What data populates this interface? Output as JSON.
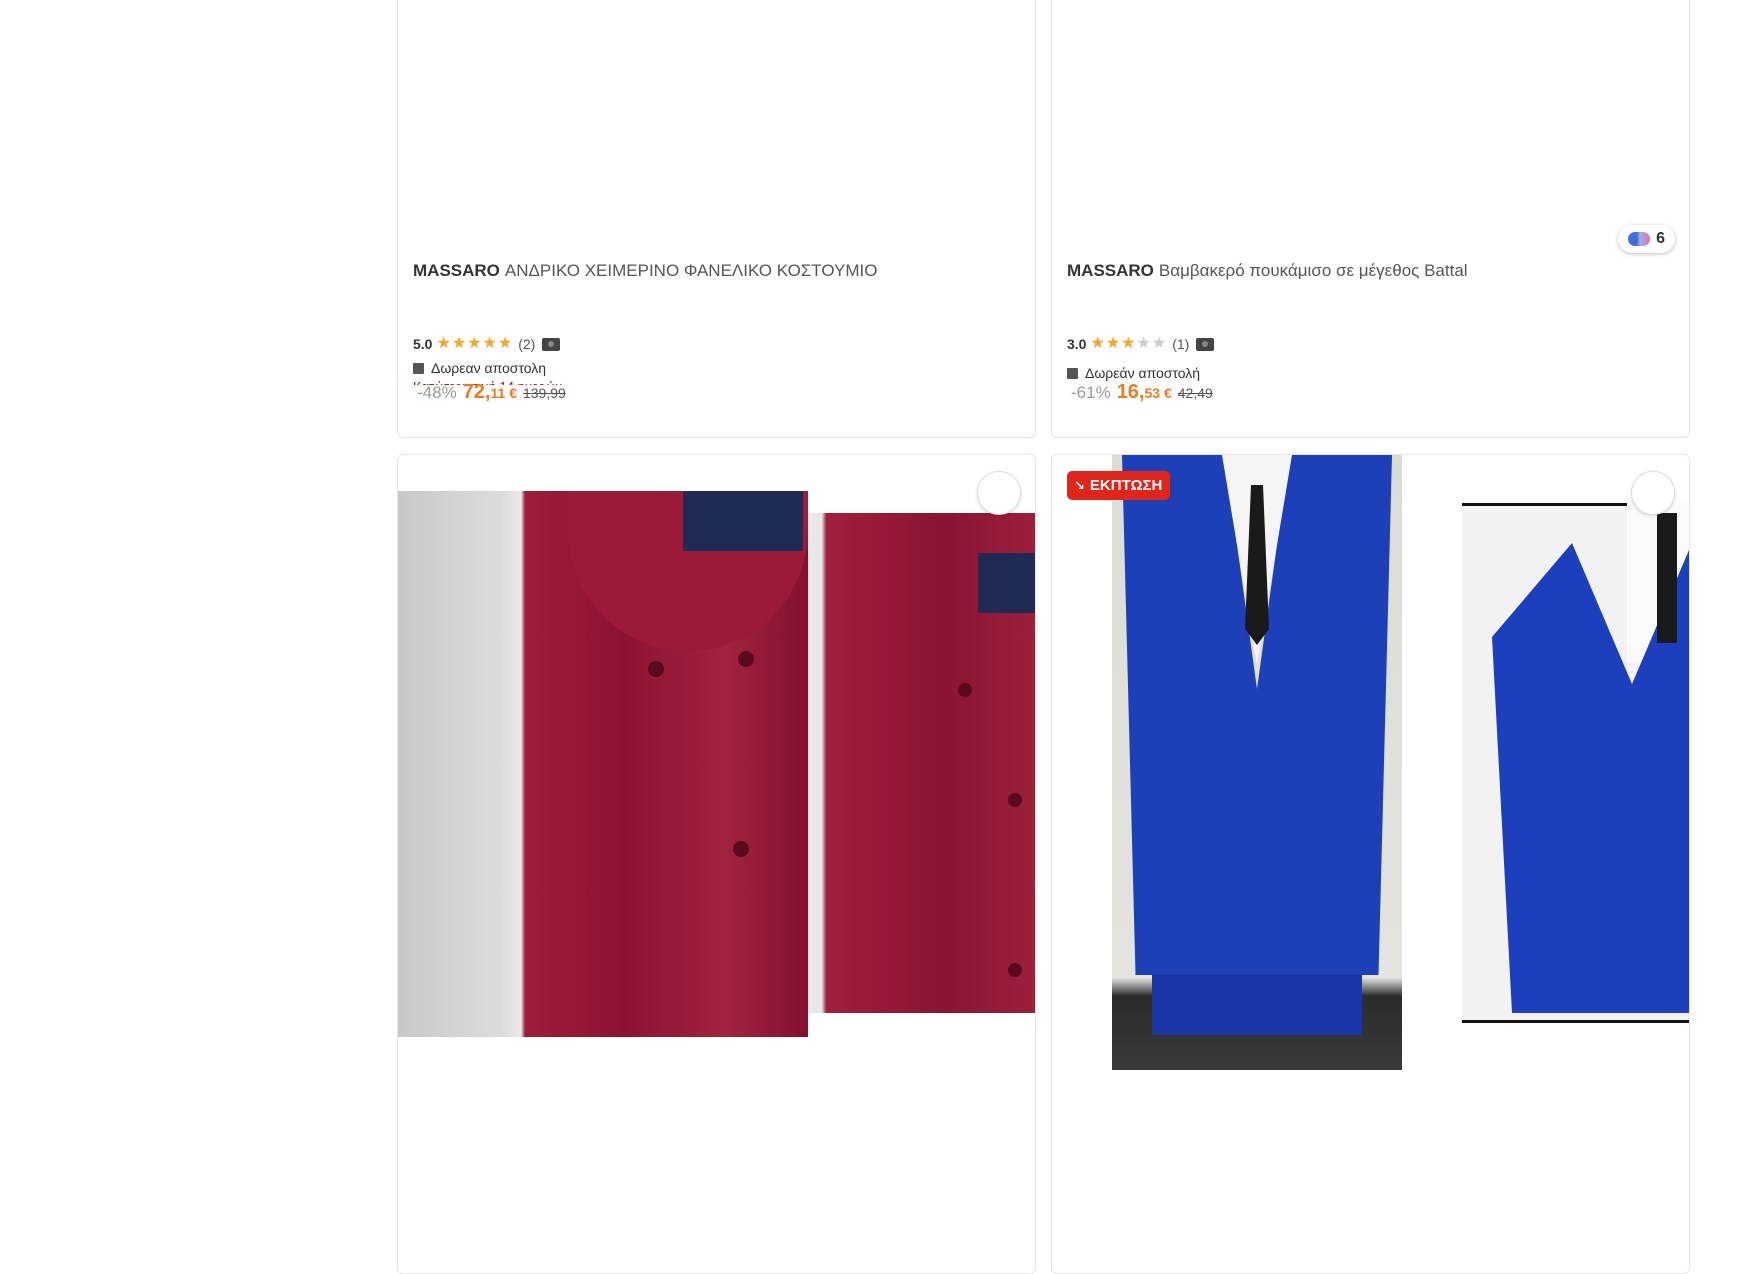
{
  "products": [
    {
      "brand": "MASSARO",
      "name": "ΑΝΔΡΙΚΟ ΧΕΙΜΕΡΙΝΟ ΦΑΝΕΛΙΚΟ ΚΟΣΤΟΥΜΙΟ",
      "rating": "5.0",
      "rating_value": 5,
      "review_count": "(2)",
      "shipping": "Δωρεαν αποστολη",
      "promo_partial": "Κατώτερη τιμή 14 ημερών",
      "discount": "-48%",
      "price_main": "72,",
      "price_cents": "11 €",
      "old_price": "139,99"
    },
    {
      "brand": "MASSARO",
      "name": "Βαμβακερό πουκάμισο σε μέγεθος Battal",
      "rating": "3.0",
      "rating_value": 3,
      "review_count": "(1)",
      "shipping": "Δωρεάν αποστολή",
      "discount": "-61%",
      "price_main": "16,",
      "price_cents": "53 €",
      "old_price": "42,49",
      "color_count": "6"
    },
    {
      "image_subject": "burgundy short-sleeve shirt"
    },
    {
      "badge": "ΕΚΠΤΩΣΗ",
      "image_subject": "royal blue three-piece suit"
    }
  ],
  "colors": {
    "price_orange": "#f27a1a",
    "star_gold": "#f6a623",
    "sale_red": "#e1251b"
  },
  "icons": [
    "star-icon",
    "camera-icon",
    "box-icon",
    "heart-icon",
    "trend-down-icon",
    "color-swatch-icon"
  ]
}
